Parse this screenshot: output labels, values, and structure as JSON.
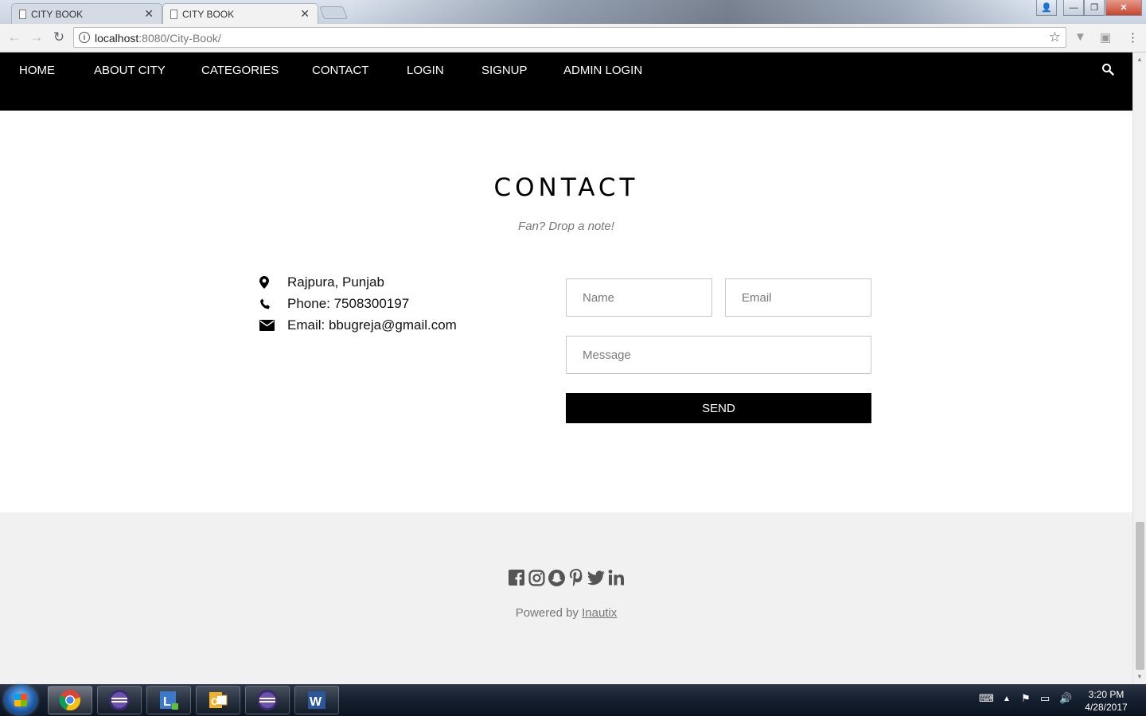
{
  "browser": {
    "tabs": [
      {
        "label": "CITY BOOK"
      },
      {
        "label": "CITY BOOK"
      }
    ],
    "url_host": "localhost",
    "url_path": ":8080/City-Book/"
  },
  "nav": {
    "items": [
      "HOME",
      "ABOUT CITY",
      "CATEGORIES",
      "CONTACT",
      "LOGIN",
      "SIGNUP",
      "ADMIN LOGIN"
    ]
  },
  "contact": {
    "title": "CONTACT",
    "subtitle": "Fan? Drop a note!",
    "address": "Rajpura, Punjab",
    "phone": "Phone: 7508300197",
    "email": "Email: bbugreja@gmail.com",
    "form": {
      "name_placeholder": "Name",
      "email_placeholder": "Email",
      "message_placeholder": "Message",
      "send_label": "SEND"
    }
  },
  "footer": {
    "social_icons": [
      "facebook-icon",
      "instagram-icon",
      "snapchat-icon",
      "pinterest-icon",
      "twitter-icon",
      "linkedin-icon"
    ],
    "powered_prefix": "Powered by",
    "powered_link": "Inautix"
  },
  "taskbar": {
    "time": "3:20 PM",
    "date": "4/28/2017"
  },
  "colors": {
    "navbar_bg": "#000000",
    "footer_bg": "#f1f1f1",
    "button_bg": "#000000",
    "social_icon": "#555555"
  }
}
